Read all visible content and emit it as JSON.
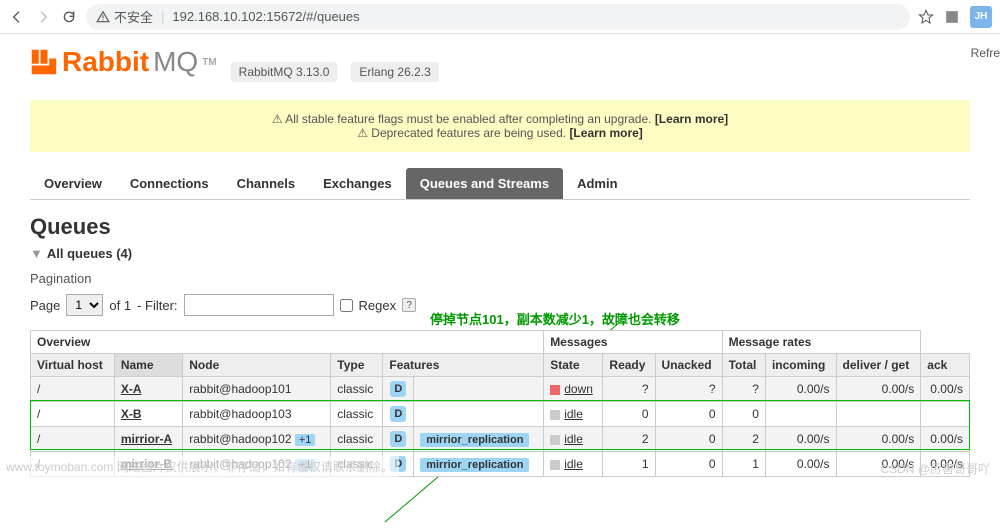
{
  "browser": {
    "security_text": "不安全",
    "url": "192.168.10.102:15672/#/queues",
    "avatar": "JH"
  },
  "header": {
    "logo_text": "Rabbit",
    "logo_mq": "MQ",
    "tm": "TM",
    "version": "RabbitMQ 3.13.0",
    "erlang": "Erlang 26.2.3",
    "refresh": "Refre"
  },
  "notice": {
    "line1a": "⚠ All stable feature flags must be enabled after completing an upgrade. ",
    "line1b": "[Learn more]",
    "line2a": "⚠ Deprecated features are being used. ",
    "line2b": "[Learn more]"
  },
  "tabs": [
    "Overview",
    "Connections",
    "Channels",
    "Exchanges",
    "Queues and Streams",
    "Admin"
  ],
  "active_tab": 4,
  "section_title": "Queues",
  "all_queues": "All queues (4)",
  "pagination_label": "Pagination",
  "pag": {
    "page_label": "Page",
    "page_value": "1",
    "of": "of 1",
    "filter_label": "- Filter:",
    "regex": "Regex",
    "help": "?"
  },
  "annotation": "停掉节点101，副本数减少1，故障也会转移",
  "table": {
    "groups": [
      "Overview",
      "Messages",
      "Message rates"
    ],
    "cols": [
      "Virtual host",
      "Name",
      "Node",
      "Type",
      "Features",
      "State",
      "Ready",
      "Unacked",
      "Total",
      "incoming",
      "deliver / get",
      "ack"
    ],
    "rows": [
      {
        "vhost": "/",
        "name": "X-A",
        "node": "rabbit@hadoop101",
        "node_badge": "",
        "type": "classic",
        "feat_d": "D",
        "feat_tag": "",
        "state": "down",
        "state_color": "down",
        "ready": "?",
        "unacked": "?",
        "total": "?",
        "incoming": "0.00/s",
        "deliver": "0.00/s",
        "ack": "0.00/s",
        "alt": true
      },
      {
        "vhost": "/",
        "name": "X-B",
        "node": "rabbit@hadoop103",
        "node_badge": "",
        "type": "classic",
        "feat_d": "D",
        "feat_tag": "",
        "state": "idle",
        "state_color": "idle",
        "ready": "0",
        "unacked": "0",
        "total": "0",
        "incoming": "",
        "deliver": "",
        "ack": "",
        "alt": false
      },
      {
        "vhost": "/",
        "name": "mirrior-A",
        "node": "rabbit@hadoop102",
        "node_badge": "+1",
        "type": "classic",
        "feat_d": "D",
        "feat_tag": "mirrior_replication",
        "state": "idle",
        "state_color": "idle",
        "ready": "2",
        "unacked": "0",
        "total": "2",
        "incoming": "0.00/s",
        "deliver": "0.00/s",
        "ack": "0.00/s",
        "alt": true
      },
      {
        "vhost": "/",
        "name": "mirrior-B",
        "node": "rabbit@hadoop102",
        "node_badge": "+1",
        "type": "classic",
        "feat_d": "D",
        "feat_tag": "mirrior_replication",
        "state": "idle",
        "state_color": "idle",
        "ready": "1",
        "unacked": "0",
        "total": "1",
        "incoming": "0.00/s",
        "deliver": "0.00/s",
        "ack": "0.00/s",
        "alt": false
      }
    ]
  },
  "watermark": "www.toymoban.com 网络图片仅供展示，非存储，如有侵权请联系删除。",
  "csdn": "CSDN @厉害哥哥吖"
}
